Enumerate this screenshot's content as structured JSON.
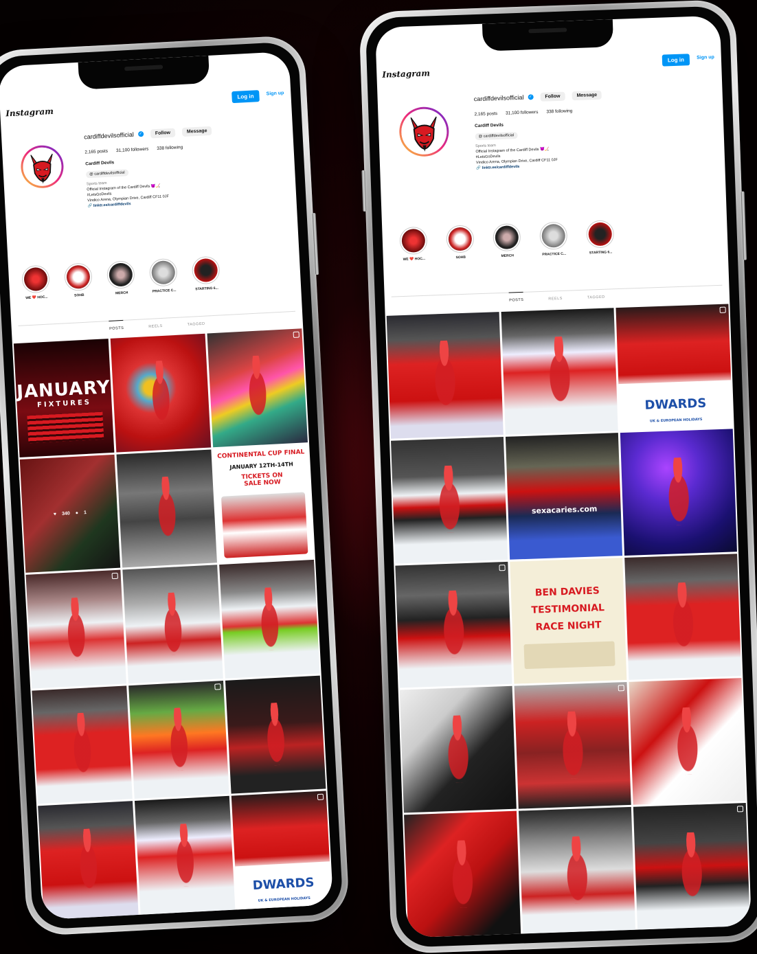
{
  "colors": {
    "devil_red": "#d71a21",
    "dark_red": "#7a0b12",
    "ice": "#eef2f5",
    "accent_blue": "#0095f6"
  },
  "app": {
    "brand": "Instagram",
    "login_label": "Log in",
    "signup_label": "Sign up"
  },
  "profile": {
    "username": "cardiffdevilsofficial",
    "verified_icon": "verified-badge-icon",
    "follow_label": "Follow",
    "message_label": "Message",
    "posts": "2,165 posts",
    "followers": "31,100 followers",
    "following": "338 following",
    "full_name": "Cardiff Devils",
    "threads_handle": "cardiffdevilsofficial",
    "category": "Sports team",
    "bio_line1": "Official Instagram of the Cardiff Devils 👿🏒",
    "bio_line2": "#LetsGoDevils",
    "bio_line3": "Vindico Arena, Olympian Drive, Cardiff CF11 0JF",
    "link": "linktr.ee/cardiffdevils"
  },
  "highlights": [
    {
      "label": "WE ❤️ HOC..."
    },
    {
      "label": "SOHB"
    },
    {
      "label": "MERCH"
    },
    {
      "label": "PRACTICE C..."
    },
    {
      "label": "STARTING 6..."
    }
  ],
  "tabs": {
    "posts": "POSTS",
    "reels": "REELS",
    "tagged": "TAGGED"
  },
  "phone1_posts": [
    {
      "kind": "january"
    },
    {
      "kind": "mascot"
    },
    {
      "kind": "crowd"
    },
    {
      "kind": "fans",
      "overlay_likes": "340",
      "overlay_comments": "1"
    },
    {
      "kind": "arena"
    },
    {
      "kind": "cup"
    },
    {
      "kind": "huddle"
    },
    {
      "kind": "rink"
    },
    {
      "kind": "faceoff"
    },
    {
      "kind": "player"
    },
    {
      "kind": "scrum"
    },
    {
      "kind": "dark"
    },
    {
      "kind": "celebrate"
    },
    {
      "kind": "skate"
    },
    {
      "kind": "sponsor"
    }
  ],
  "phone2_posts": [
    {
      "kind": "celebrate"
    },
    {
      "kind": "skate"
    },
    {
      "kind": "sponsor"
    },
    {
      "kind": "goalie"
    },
    {
      "kind": "wessex"
    },
    {
      "kind": "party"
    },
    {
      "kind": "team-dark"
    },
    {
      "kind": "testimonial"
    },
    {
      "kind": "player"
    },
    {
      "kind": "camera"
    },
    {
      "kind": "stands"
    },
    {
      "kind": "facepaint"
    },
    {
      "kind": "fans-red"
    },
    {
      "kind": "scoreboard"
    },
    {
      "kind": "dark-player"
    }
  ],
  "graphics": {
    "january_title": "JANUARY",
    "january_sub": "FIXTURES",
    "cup_title": "CONTINENTAL CUP FINAL",
    "cup_dates": "JANUARY 12TH-14TH",
    "cup_tickets": "TICKETS ON SALE NOW",
    "testimonial_l1": "BEN DAVIES",
    "testimonial_l2": "TESTIMONIAL",
    "testimonial_l3": "RACE NIGHT",
    "sponsor_text": "DWARDS",
    "sponsor_sub": "UK & EUROPEAN HOLIDAYS",
    "wessex_text": "sexacaries.com"
  }
}
